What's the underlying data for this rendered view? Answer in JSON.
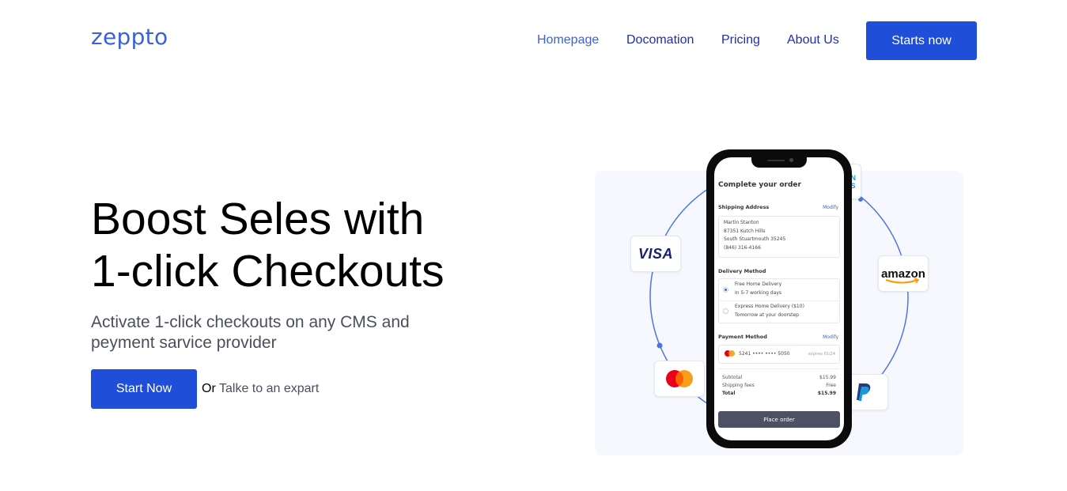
{
  "header": {
    "logo": "zeppto",
    "nav": [
      "Homepage",
      "Docomation",
      "Pricing",
      "About Us"
    ],
    "cta": "Starts now"
  },
  "hero": {
    "title_line1": "Boost Seles with",
    "title_line2": "1-click Checkouts",
    "subtitle": "Activate 1-click checkouts on any CMS and peyment sarvice provider",
    "primary_button": "Start Now",
    "or_text": "Or",
    "secondary_link": "Talke to an expart"
  },
  "illustration": {
    "payment_badges": [
      "visa-logo",
      "amazon-logo",
      "mastercard-logo",
      "paypal-logo"
    ],
    "badge_visa_text": "VISA",
    "badge_amazon_text": "amazon",
    "phone": {
      "title": "Complete your order",
      "shipping_label": "Shipping Address",
      "shipping_modify": "Modify",
      "address": [
        "Martin Stanton",
        "87351 Kutch Hills",
        "South Stuartmouth 35245",
        "(846) 316-4166"
      ],
      "delivery_label": "Delivery Method",
      "delivery_options": [
        {
          "name": "Free Home Delivery",
          "detail": "In 5-7 working days",
          "selected": true
        },
        {
          "name": "Express Home Delivery ($10)",
          "detail": "Tomorrow at your doorstep",
          "selected": false
        }
      ],
      "payment_label": "Payment Method",
      "payment_modify": "Modify",
      "card_number": "5241 •••• •••• 5050",
      "card_expiry": "expires 01/24",
      "summary": [
        {
          "label": "Subtotal",
          "value": "$15.99"
        },
        {
          "label": "Shipping fees",
          "value": "Free"
        },
        {
          "label": "Total",
          "value": "$15.99"
        }
      ],
      "place_order": "Place order"
    }
  },
  "colors": {
    "brand": "#3a62d7",
    "button": "#1f4fd8",
    "nav_link": "#1d2fb0",
    "ring": "#4f74e0",
    "place_order": "#4c5263"
  }
}
